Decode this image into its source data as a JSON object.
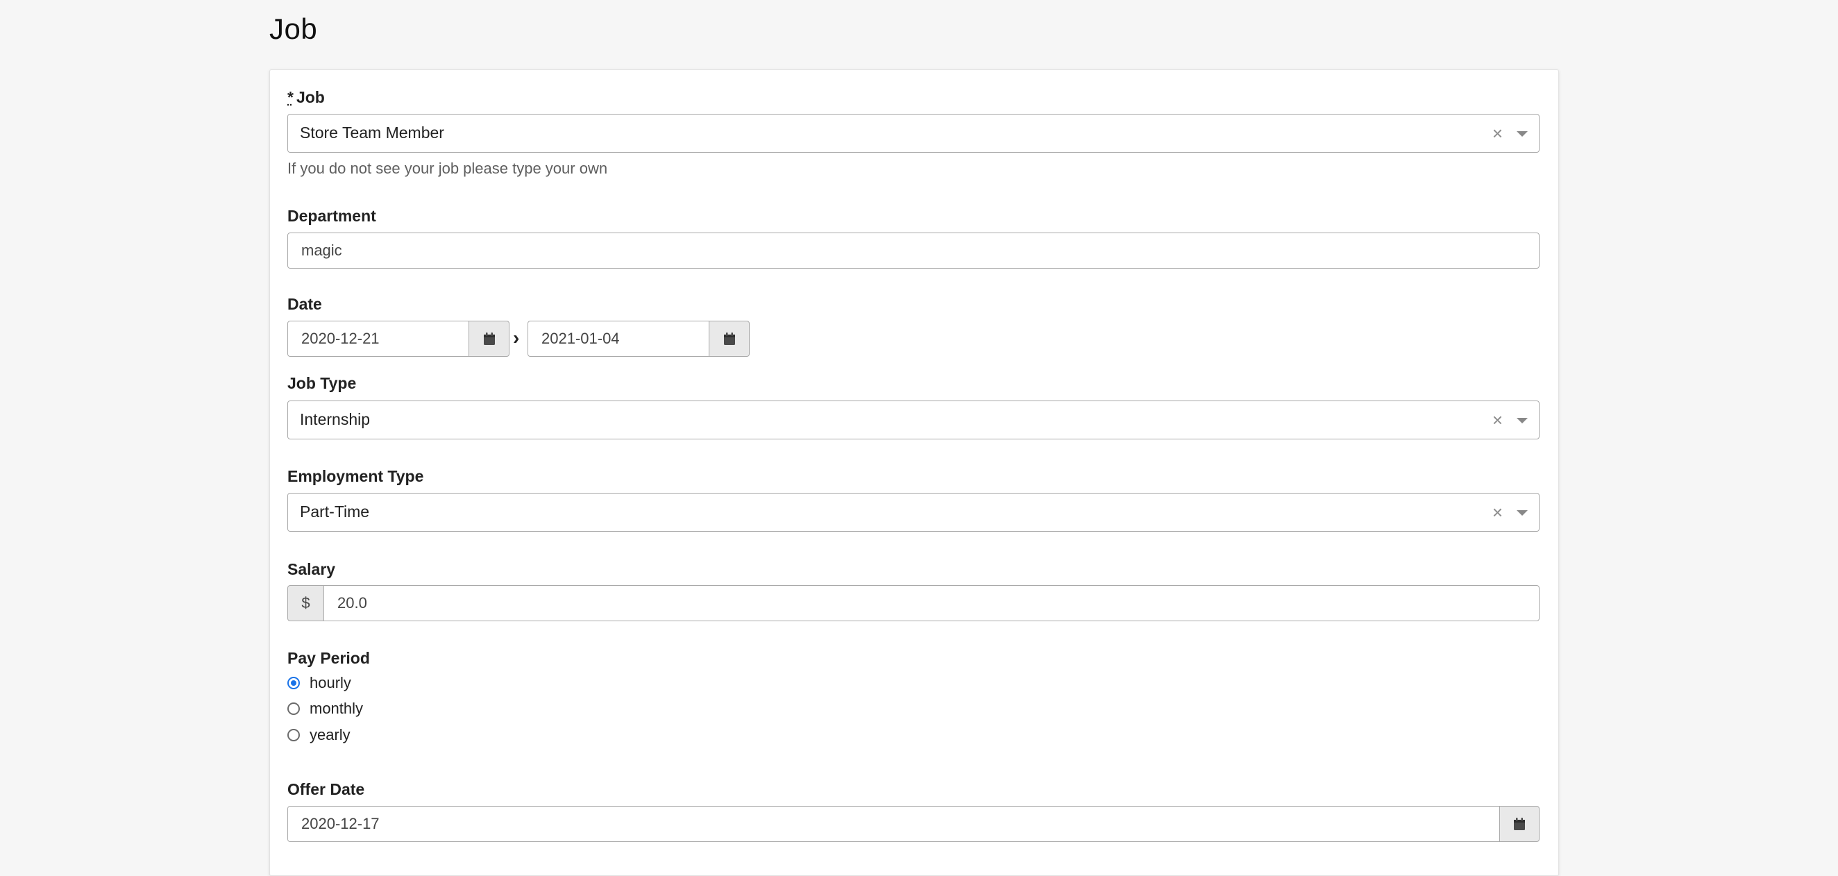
{
  "page": {
    "title": "Job"
  },
  "form": {
    "job": {
      "required_mark": "*",
      "label": "Job",
      "value": "Store Team Member",
      "help": "If you do not see your job please type your own",
      "clear_icon": "close-icon",
      "dropdown_icon": "chevron-down-icon"
    },
    "department": {
      "label": "Department",
      "value": "magic"
    },
    "date": {
      "label": "Date",
      "start": "2020-12-21",
      "end": "2021-01-04",
      "separator": "›",
      "calendar_icon": "calendar-icon"
    },
    "job_type": {
      "label": "Job Type",
      "value": "Internship"
    },
    "employment_type": {
      "label": "Employment Type",
      "value": "Part-Time"
    },
    "salary": {
      "label": "Salary",
      "prefix": "$",
      "value": "20.0"
    },
    "pay_period": {
      "label": "Pay Period",
      "options": [
        "hourly",
        "monthly",
        "yearly"
      ],
      "selected": "hourly"
    },
    "offer_date": {
      "label": "Offer Date",
      "value": "2020-12-17"
    }
  },
  "colors": {
    "background": "#f6f6f6",
    "card": "#ffffff",
    "border": "#a9a9a9",
    "addon": "#e9e9e9",
    "radio_selected": "#1a73e8"
  }
}
